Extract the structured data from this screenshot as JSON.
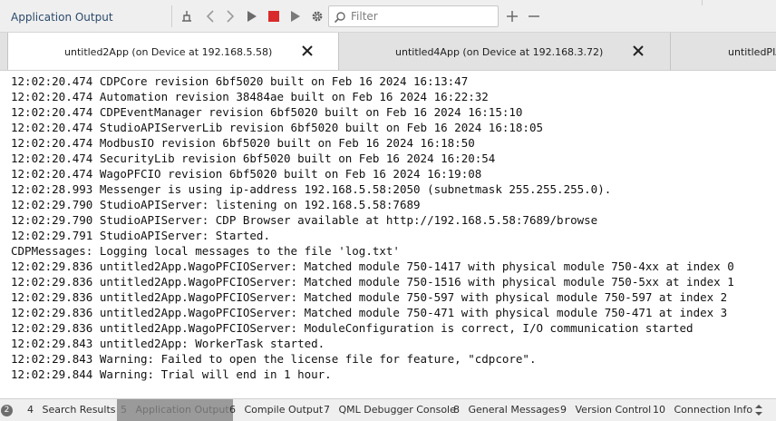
{
  "toolbar": {
    "pane_title": "Application Output",
    "filter_placeholder": "Filter",
    "icons": [
      "clean-icon",
      "prev-icon",
      "next-icon",
      "run-icon",
      "stop-icon",
      "attach-debug-icon",
      "settings-icon",
      "zoom-in-icon",
      "zoom-out-icon"
    ],
    "stop_color": "#d92b2b"
  },
  "tabs": [
    {
      "label": "untitled2App (on Device at 192.168.5.58)",
      "active": true
    },
    {
      "label": "untitled4App (on Device at 192.168.3.72)",
      "active": false
    },
    {
      "label": "untitledPIA",
      "active": false
    }
  ],
  "output_lines": [
    "12:02:20.474 CDPCore revision 6bf5020 built on Feb 16 2024 16:13:47",
    "12:02:20.474 Automation revision 38484ae built on Feb 16 2024 16:22:32",
    "12:02:20.474 CDPEventManager revision 6bf5020 built on Feb 16 2024 16:15:10",
    "12:02:20.474 StudioAPIServerLib revision 6bf5020 built on Feb 16 2024 16:18:05",
    "12:02:20.474 ModbusIO revision 6bf5020 built on Feb 16 2024 16:18:50",
    "12:02:20.474 SecurityLib revision 6bf5020 built on Feb 16 2024 16:20:54",
    "12:02:20.474 WagoPFCIO revision 6bf5020 built on Feb 16 2024 16:19:08",
    "12:02:28.993 Messenger is using ip-address 192.168.5.58:2050 (subnetmask 255.255.255.0).",
    "12:02:29.790 StudioAPIServer: listening on 192.168.5.58:7689",
    "12:02:29.790 StudioAPIServer: CDP Browser available at http://192.168.5.58:7689/browse",
    "12:02:29.791 StudioAPIServer: Started.",
    "CDPMessages: Logging local messages to the file 'log.txt'",
    "12:02:29.836 untitled2App.WagoPFCIOServer: Matched module 750-1417 with physical module 750-4xx at index 0",
    "12:02:29.836 untitled2App.WagoPFCIOServer: Matched module 750-1516 with physical module 750-5xx at index 1",
    "12:02:29.836 untitled2App.WagoPFCIOServer: Matched module 750-597 with physical module 750-597 at index 2",
    "12:02:29.836 untitled2App.WagoPFCIOServer: Matched module 750-471 with physical module 750-471 at index 3",
    "12:02:29.836 untitled2App.WagoPFCIOServer: ModuleConfiguration is correct, I/O communication started",
    "12:02:29.843 untitled2App: WorkerTask started.",
    "12:02:29.843 Warning: Failed to open the license file for feature, \"cdpcore\".",
    "12:02:29.844 Warning: Trial will end in 1 hour."
  ],
  "bottom": {
    "badge": "2",
    "tabs": [
      {
        "num": "4",
        "label": "Search Results",
        "active": false
      },
      {
        "num": "5",
        "label": "Application Output",
        "active": true
      },
      {
        "num": "6",
        "label": "Compile Output",
        "active": false
      },
      {
        "num": "7",
        "label": "QML Debugger Console",
        "active": false
      },
      {
        "num": "8",
        "label": "General Messages",
        "active": false
      },
      {
        "num": "9",
        "label": "Version Control",
        "active": false
      },
      {
        "num": "10",
        "label": "Connection Info",
        "active": false
      }
    ]
  }
}
